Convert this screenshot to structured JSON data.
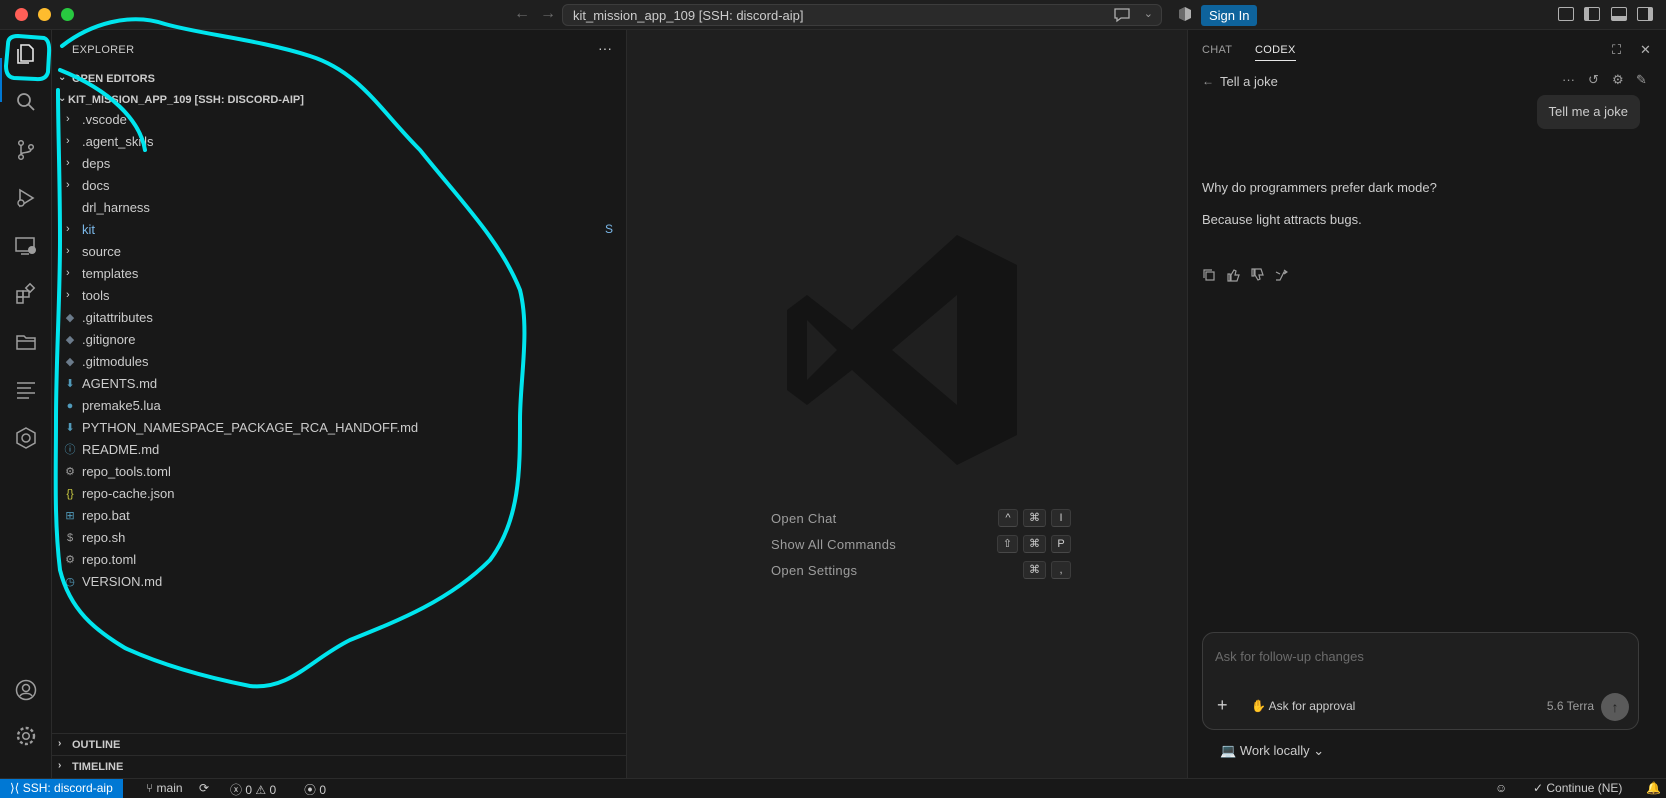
{
  "titlebar": {
    "command_center": "kit_mission_app_109 [SSH: discord-aip]",
    "sign_in": "Sign In"
  },
  "explorer": {
    "title": "EXPLORER",
    "more": "···",
    "open_editors": "OPEN EDITORS",
    "workspace": "KIT_MISSION_APP_109 [SSH: DISCORD-AIP]",
    "items": [
      {
        "name": ".vscode",
        "type": "folder",
        "icon": ""
      },
      {
        "name": ".agent_skills",
        "type": "folder",
        "icon": ""
      },
      {
        "name": "deps",
        "type": "folder",
        "icon": ""
      },
      {
        "name": "docs",
        "type": "folder",
        "icon": ""
      },
      {
        "name": "drl_harness",
        "type": "folder-noarrow",
        "icon": ""
      },
      {
        "name": "kit",
        "type": "folder",
        "icon": "",
        "badge": "S"
      },
      {
        "name": "source",
        "type": "folder",
        "icon": ""
      },
      {
        "name": "templates",
        "type": "folder",
        "icon": ""
      },
      {
        "name": "tools",
        "type": "folder",
        "icon": ""
      },
      {
        "name": ".gitattributes",
        "type": "file",
        "icon": "◆"
      },
      {
        "name": ".gitignore",
        "type": "file",
        "icon": "◆"
      },
      {
        "name": ".gitmodules",
        "type": "file",
        "icon": "◆"
      },
      {
        "name": "AGENTS.md",
        "type": "file",
        "icon": "⬇"
      },
      {
        "name": "premake5.lua",
        "type": "file",
        "icon": "●"
      },
      {
        "name": "PYTHON_NAMESPACE_PACKAGE_RCA_HANDOFF.md",
        "type": "file",
        "icon": "⬇"
      },
      {
        "name": "README.md",
        "type": "file",
        "icon": "ⓘ"
      },
      {
        "name": "repo_tools.toml",
        "type": "file",
        "icon": "⚙"
      },
      {
        "name": "repo-cache.json",
        "type": "file",
        "icon": "{}"
      },
      {
        "name": "repo.bat",
        "type": "file",
        "icon": "⊞"
      },
      {
        "name": "repo.sh",
        "type": "file",
        "icon": "$"
      },
      {
        "name": "repo.toml",
        "type": "file",
        "icon": "⚙"
      },
      {
        "name": "VERSION.md",
        "type": "file",
        "icon": "◷"
      }
    ],
    "outline": "OUTLINE",
    "timeline": "TIMELINE"
  },
  "editor": {
    "shortcuts": [
      {
        "label": "Open Chat",
        "keys": [
          "^",
          "⌘",
          "I"
        ]
      },
      {
        "label": "Show All Commands",
        "keys": [
          "⇧",
          "⌘",
          "P"
        ]
      },
      {
        "label": "Open Settings",
        "keys": [
          "⌘",
          ","
        ]
      }
    ]
  },
  "chat": {
    "tabs": [
      "CHAT",
      "CODEX"
    ],
    "thread_title": "Tell a joke",
    "user_message": "Tell me a joke",
    "reply_line1": "Why do programmers prefer dark mode?",
    "reply_line2": "Because light attracts bugs.",
    "input_placeholder": "Ask for follow-up changes",
    "approval": "Ask for approval",
    "model": "5.6 Terra",
    "work_locally": "Work locally"
  },
  "statusbar": {
    "remote": "SSH: discord-aip",
    "branch": "main",
    "errors": "0",
    "warnings": "0",
    "ports": "0",
    "continue": "Continue (NE)"
  },
  "colors": {
    "accent": "#0078d4",
    "annotation": "#00e5ee"
  }
}
